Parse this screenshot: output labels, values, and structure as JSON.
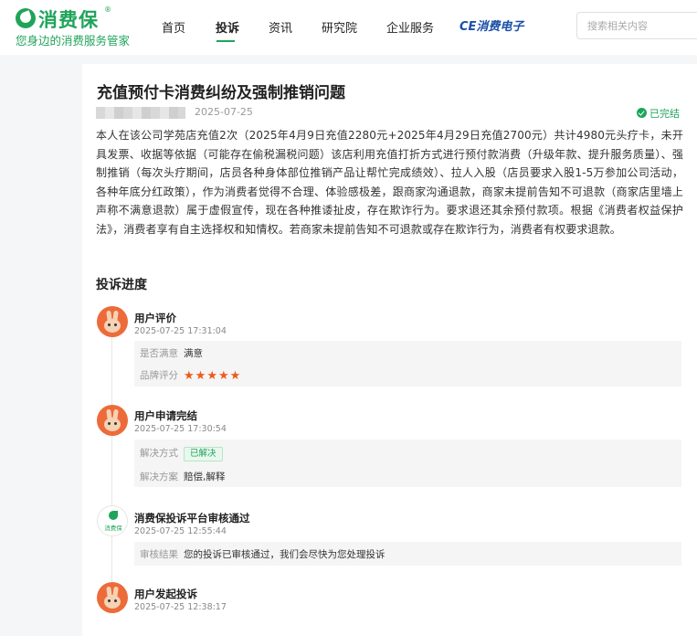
{
  "header": {
    "logo_name": "消费保",
    "logo_reg": "®",
    "slogan": "您身边的消费服务管家",
    "nav": [
      {
        "label": "首页"
      },
      {
        "label": "投诉"
      },
      {
        "label": "资讯"
      },
      {
        "label": "研究院"
      },
      {
        "label": "企业服务"
      }
    ],
    "partner_logo": "CE消费电子",
    "search_placeholder": "搜索相关内容"
  },
  "complaint": {
    "title": "充值预付卡消费纠纷及强制推销问题",
    "date": "2025-07-25",
    "status": "已完结",
    "body": "本人在该公司学苑店充值2次（2025年4月9日充值2280元+2025年4月29日充值2700元）共计4980元头疗卡，未开具发票、收据等依据（可能存在偷税漏税问题）该店利用充值打折方式进行预付款消费（升级年款、提升服务质量）、强制推销（每次头疗期间，店员各种身体部位推销产品让帮忙完成绩效）、拉人入股（店员要求入股1-5万参加公司活动，各种年底分红政策），作为消费者觉得不合理、体验感极差，跟商家沟通退款，商家未提前告知不可退款（商家店里墙上声称不满意退款）属于虚假宣传，现在各种推诿扯皮，存在欺诈行为。要求退还其余预付款项。根据《消费者权益保护法》，消费者享有自主选择权和知情权。若商家未提前告知不可退款或存在欺诈行为，消费者有权要求退款。"
  },
  "progress": {
    "title": "投诉进度",
    "events": [
      {
        "title": "用户评价",
        "time": "2025-07-25 17:31:04",
        "rows": [
          {
            "label": "是否满意",
            "value": "满意"
          },
          {
            "label": "品牌评分",
            "stars": 5
          }
        ]
      },
      {
        "title": "用户申请完结",
        "time": "2025-07-25 17:30:54",
        "rows": [
          {
            "label": "解决方式",
            "badge": "已解决"
          },
          {
            "label": "解决方案",
            "value": "赔偿,解释"
          }
        ]
      },
      {
        "title": "消费保投诉平台审核通过",
        "time": "2025-07-25 12:55:44",
        "avatar_text": "消费保",
        "rows": [
          {
            "label": "审核结果",
            "value": "您的投诉已审核通过，我们会尽快为您处理投诉"
          }
        ]
      },
      {
        "title": "用户发起投诉",
        "time": "2025-07-25 12:38:17"
      }
    ]
  },
  "colors": {
    "brand_green": "#1fa45a",
    "star_orange": "#f05a1a",
    "avatar_orange": "#ed6b3a"
  }
}
